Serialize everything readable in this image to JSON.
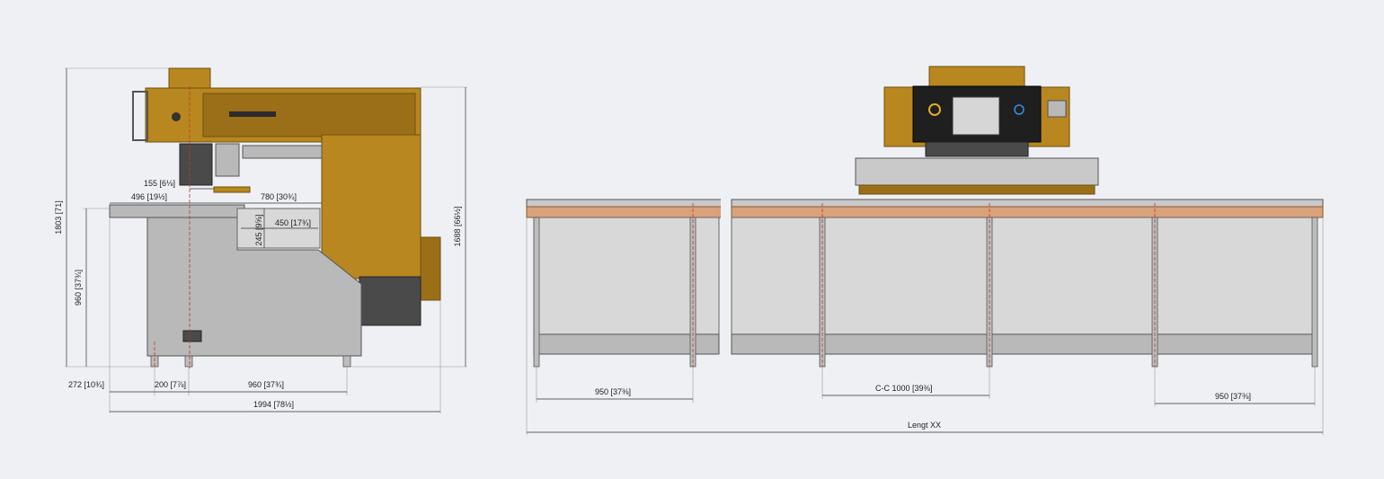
{
  "colors": {
    "background": "#eef0f4",
    "machine_gold": "#b8871f",
    "steel_grey": "#b9b9b9",
    "table_wood": "#d9a27a",
    "centerline_red": "#c0392b"
  },
  "side_view": {
    "dimensions": {
      "overall_height": "1803 [71]",
      "right_height": "1688 [66½]",
      "table_height": "960 [37¾]",
      "tool_offset": "155 [6⅛]",
      "reach_left": "496 [19½]",
      "throat_depth": "780 [30¾]",
      "opening_width": "450 [17¾]",
      "opening_height": "245 [9⅝]",
      "left_overhang": "272 [10¾]",
      "foot_spacing": "200 [7⅞]",
      "foot_to_foot": "960 [37¾]",
      "overall_depth": "1994 [78½]"
    }
  },
  "front_view": {
    "dimensions": {
      "left_module": "950 [37⅜]",
      "center_spacing": "C-C 1000 [39⅜]",
      "right_module": "950 [37⅜]",
      "overall_length": "Lengt XX"
    }
  }
}
